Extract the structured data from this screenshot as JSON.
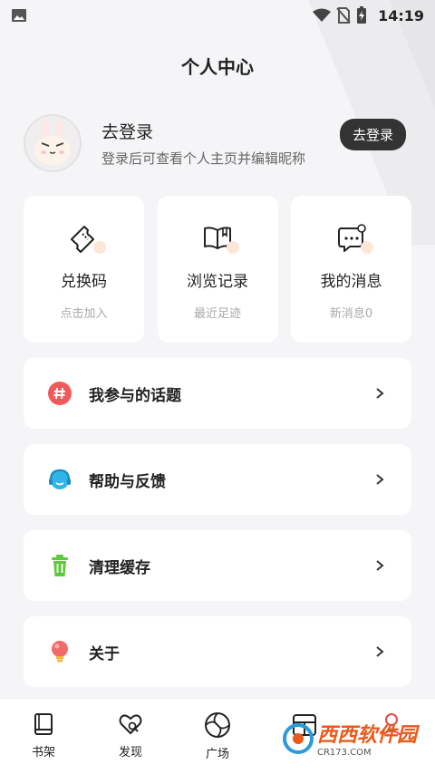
{
  "status_bar": {
    "time": "14:19"
  },
  "page": {
    "title": "个人中心"
  },
  "profile": {
    "name": "去登录",
    "subtitle": "登录后可查看个人主页并编辑昵称",
    "login_button": "去登录"
  },
  "cards": [
    {
      "title": "兑换码",
      "subtitle": "点击加入",
      "icon": "ticket-icon"
    },
    {
      "title": "浏览记录",
      "subtitle": "最近足迹",
      "icon": "book-open-icon"
    },
    {
      "title": "我的消息",
      "subtitle": "新消息0",
      "icon": "message-icon"
    }
  ],
  "menu": [
    {
      "label": "我参与的话题",
      "icon": "hashtag-icon",
      "color": "#f05a5a"
    },
    {
      "label": "帮助与反馈",
      "icon": "headset-icon",
      "color": "#2fb5e8"
    },
    {
      "label": "清理缓存",
      "icon": "trash-icon",
      "color": "#5cc93a"
    },
    {
      "label": "关于",
      "icon": "lightbulb-icon",
      "color": "#f26a6a"
    }
  ],
  "tabbar": [
    {
      "label": "书架",
      "icon": "bookshelf-icon"
    },
    {
      "label": "发现",
      "icon": "discover-icon"
    },
    {
      "label": "广场",
      "icon": "plaza-icon"
    },
    {
      "label": "",
      "icon": "category-icon"
    },
    {
      "label": "",
      "icon": "profile-icon"
    }
  ],
  "watermark": {
    "text": "西西软件园",
    "sub": "CR173.COM"
  }
}
